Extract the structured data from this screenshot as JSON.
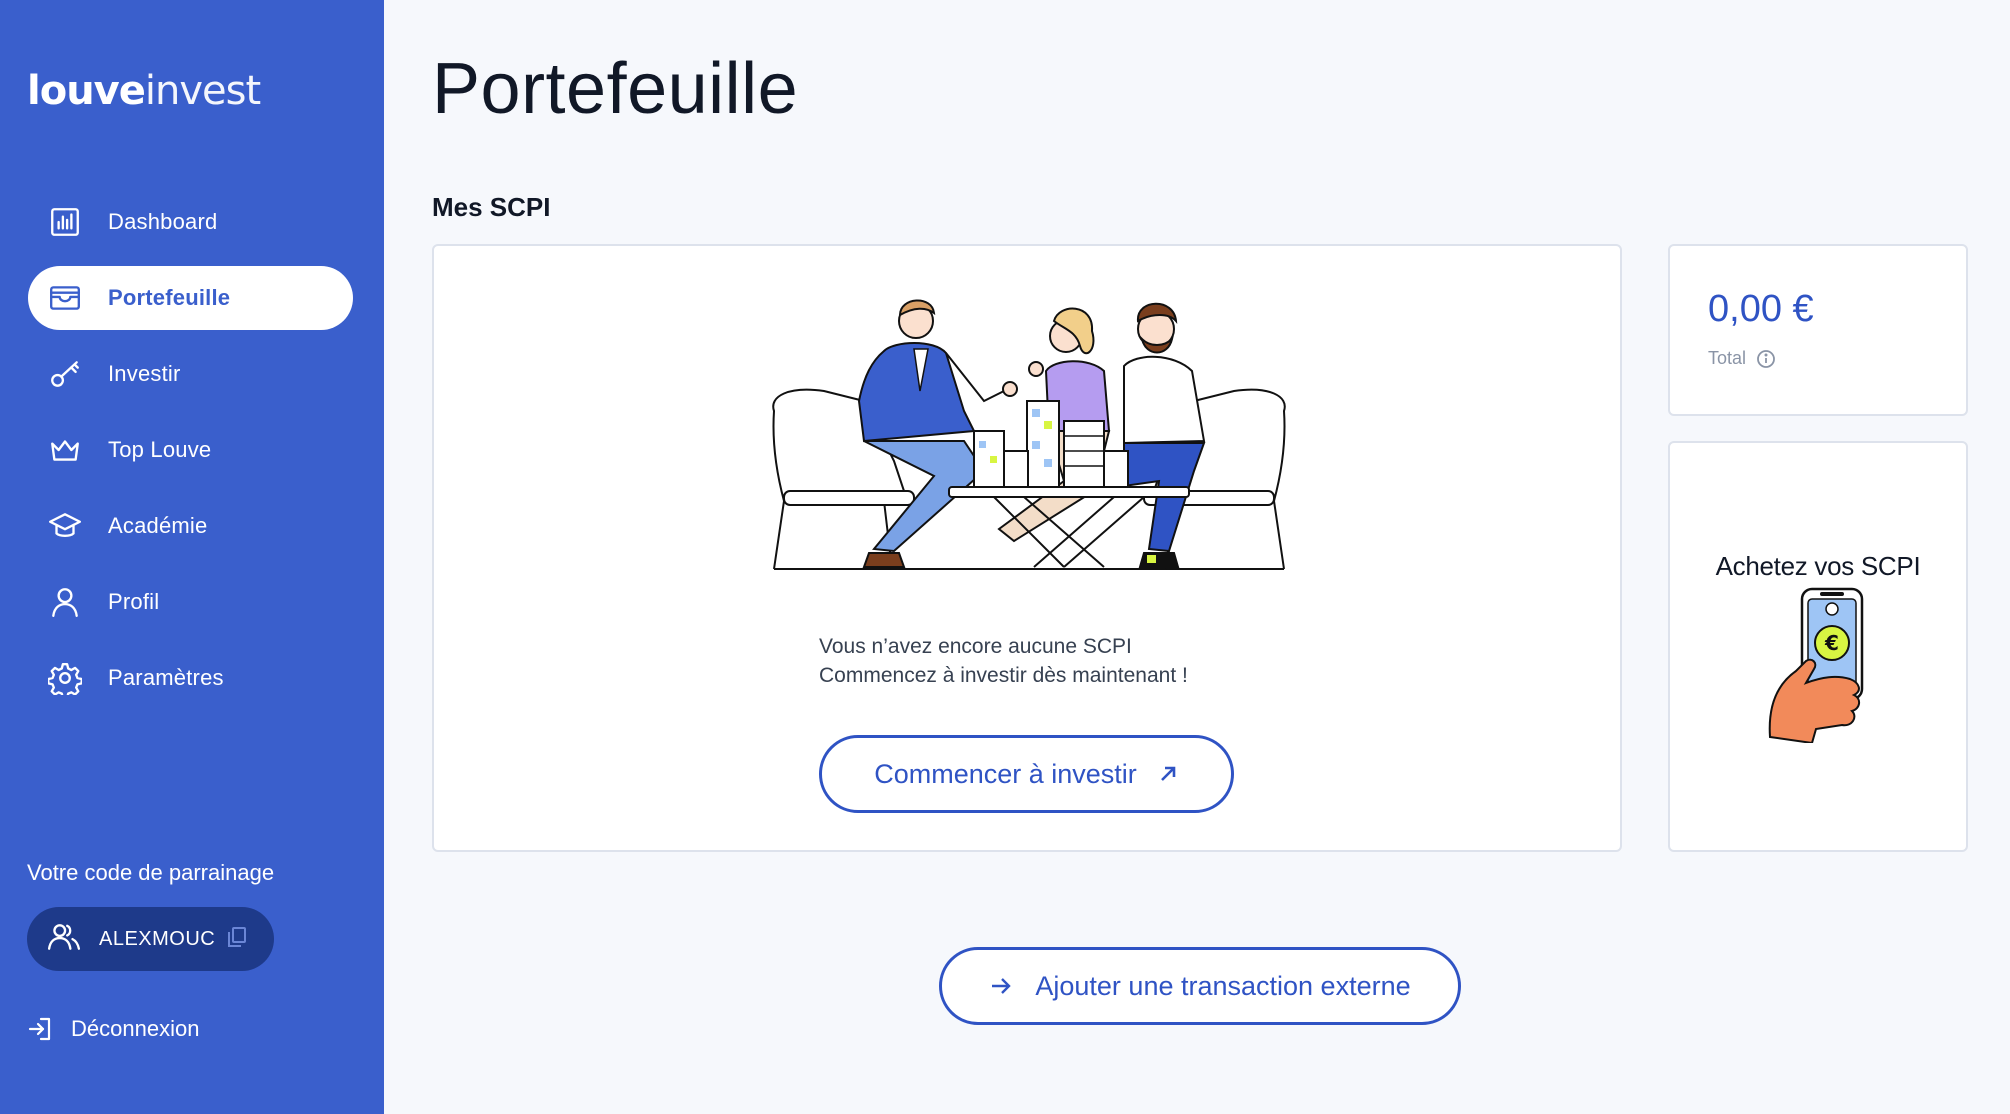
{
  "sidebar": {
    "logo": {
      "part1": "louve",
      "part2": "invest"
    },
    "items": [
      {
        "label": "Dashboard",
        "icon": "chart-icon",
        "active": false
      },
      {
        "label": "Portefeuille",
        "icon": "wallet-icon",
        "active": true
      },
      {
        "label": "Investir",
        "icon": "key-icon",
        "active": false
      },
      {
        "label": "Top Louve",
        "icon": "crown-icon",
        "active": false
      },
      {
        "label": "Académie",
        "icon": "graduation-cap-icon",
        "active": false
      },
      {
        "label": "Profil",
        "icon": "user-icon",
        "active": false
      },
      {
        "label": "Paramètres",
        "icon": "gear-icon",
        "active": false
      }
    ],
    "referral_label": "Votre code de parrainage",
    "referral_code": "ALEXMOUC",
    "logout": "Déconnexion"
  },
  "main": {
    "title": "Portefeuille",
    "section_title": "Mes SCPI",
    "empty_line1": "Vous n’avez encore aucune SCPI",
    "empty_line2": "Commencez à investir dès maintenant !",
    "start_button": "Commencer à investir",
    "total_amount": "0,00 €",
    "total_label": "Total",
    "buy_title": "Achetez vos SCPI",
    "external_button": "Ajouter une transaction externe"
  },
  "colors": {
    "sidebar_bg": "#3a5fcc",
    "accent": "#2f53c4",
    "referral_bg": "#1e3a8a",
    "page_bg": "#f6f8fc"
  }
}
